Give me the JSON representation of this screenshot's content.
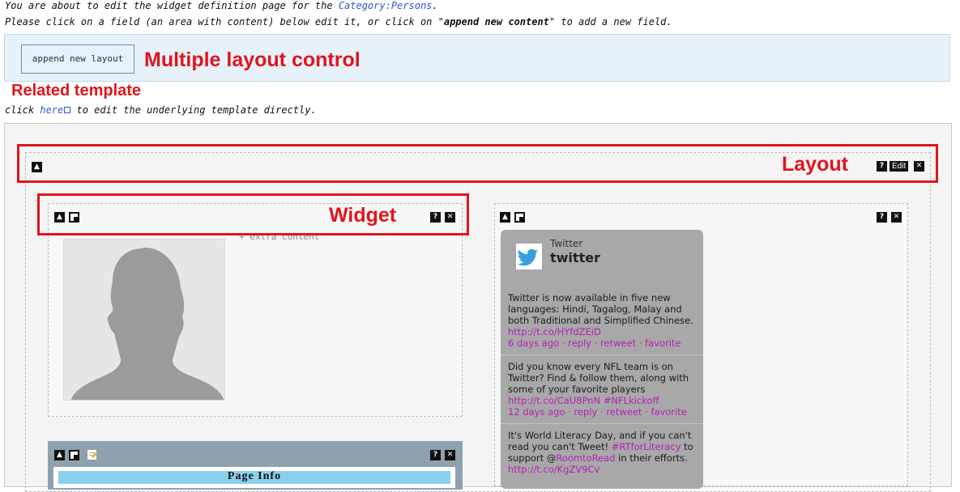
{
  "intro": {
    "line1_prefix": "You are about to edit the widget definition page for the ",
    "category_link": "Category:Persons",
    "line1_suffix": ".",
    "line2_prefix": "Please click on a field (an area with content) below edit it, or click on \"",
    "line2_bold": "append new content",
    "line2_suffix": "\" to add a new field."
  },
  "controls": {
    "append_layout_label": "append new layout"
  },
  "annotations": {
    "multiple_layout_control": "Multiple layout control",
    "related_template": "Related template",
    "layout": "Layout",
    "widget": "Widget"
  },
  "template_line": {
    "prefix": "click ",
    "link": "here",
    "suffix": " to edit the underlying template directly."
  },
  "layout_toolbar": {
    "help": "?",
    "edit": "Edit",
    "close": "✕",
    "collapse": "▲"
  },
  "widget_left": {
    "extra_content": "+ extra content"
  },
  "twitter": {
    "small_name": "Twitter",
    "big_name": "twitter",
    "tweets": [
      {
        "text": "Twitter is now available in five new languages: Hindi, Tagalog, Malay and both Traditional and Simplified Chinese.",
        "url": "http://t.co/HYfdZEiD",
        "time": "6 days ago",
        "reply": "reply",
        "retweet": "retweet",
        "favorite": "favorite"
      },
      {
        "text": "Did you know every NFL team is on Twitter? Find & follow them, along with some of your favorite players",
        "url": "http://t.co/CaU8PnN",
        "hashtag": "#NFLkickoff",
        "time": "12 days ago",
        "reply": "reply",
        "retweet": "retweet",
        "favorite": "favorite"
      },
      {
        "text_a": "It's World Literacy Day, and if you can't read you can't Tweet! ",
        "hashtag": "#RTforLiteracy",
        "text_b": " to support @",
        "mention": "RoomtoRead",
        "text_c": " in their efforts.",
        "url": "http://t.co/KgZV9Cv"
      }
    ]
  },
  "widget_bottom": {
    "page_info": "Page Info"
  },
  "colors": {
    "annotation_red": "#e0151d",
    "control_bar": "#e6f1fa",
    "twitter_card": "#a8a8a8",
    "link_magenta": "#b71fb7"
  }
}
